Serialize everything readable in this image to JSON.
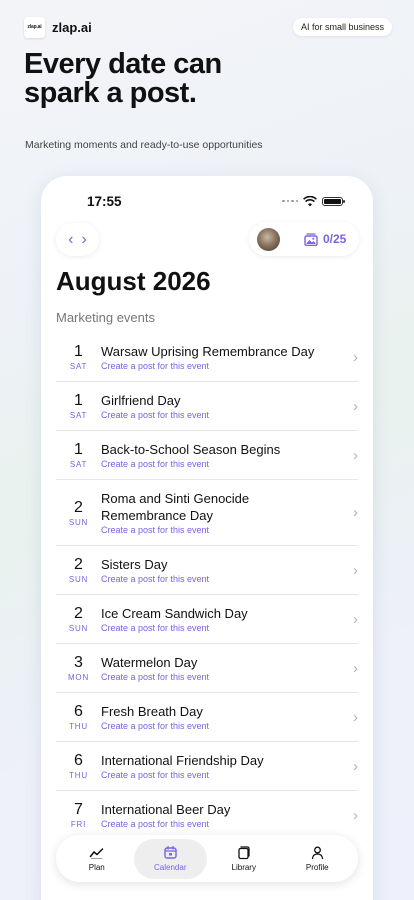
{
  "brand": {
    "logo_text": "zlap.ai",
    "name": "zlap.ai",
    "tag": "AI for small business"
  },
  "hero": {
    "title": "Every date can\nspark a post.",
    "subtitle": "Marketing moments and ready-to-use opportunities"
  },
  "status_bar": {
    "time": "17:55"
  },
  "header": {
    "prev_icon": "chevron-left-icon",
    "next_icon": "chevron-right-icon",
    "counter": "0/25",
    "counter_icon": "image-stack-icon"
  },
  "month_title": "August 2026",
  "section_label": "Marketing events",
  "events": [
    {
      "day": "1",
      "weekday": "SAT",
      "title": "Warsaw Uprising Remembrance Day",
      "action": "Create a post for this event"
    },
    {
      "day": "1",
      "weekday": "SAT",
      "title": "Girlfriend Day",
      "action": "Create a post for this event"
    },
    {
      "day": "1",
      "weekday": "SAT",
      "title": "Back-to-School Season Begins",
      "action": "Create a post for this event"
    },
    {
      "day": "2",
      "weekday": "SUN",
      "title": "Roma and Sinti Genocide Remembrance Day",
      "action": "Create a post for this event"
    },
    {
      "day": "2",
      "weekday": "SUN",
      "title": "Sisters Day",
      "action": "Create a post for this event"
    },
    {
      "day": "2",
      "weekday": "SUN",
      "title": "Ice Cream Sandwich Day",
      "action": "Create a post for this event"
    },
    {
      "day": "3",
      "weekday": "MON",
      "title": "Watermelon Day",
      "action": "Create a post for this event"
    },
    {
      "day": "6",
      "weekday": "THU",
      "title": "Fresh Breath Day",
      "action": "Create a post for this event"
    },
    {
      "day": "6",
      "weekday": "THU",
      "title": "International Friendship Day",
      "action": "Create a post for this event"
    },
    {
      "day": "7",
      "weekday": "FRI",
      "title": "International Beer Day",
      "action": "Create a post for this event"
    }
  ],
  "tabs": [
    {
      "label": "Plan",
      "icon": "trend-line-icon",
      "active": false
    },
    {
      "label": "Calendar",
      "icon": "calendar-icon",
      "active": true
    },
    {
      "label": "Library",
      "icon": "library-icon",
      "active": false
    },
    {
      "label": "Profile",
      "icon": "user-icon",
      "active": false
    }
  ],
  "colors": {
    "accent": "#7b62e0",
    "text": "#111111",
    "muted": "#777777"
  }
}
